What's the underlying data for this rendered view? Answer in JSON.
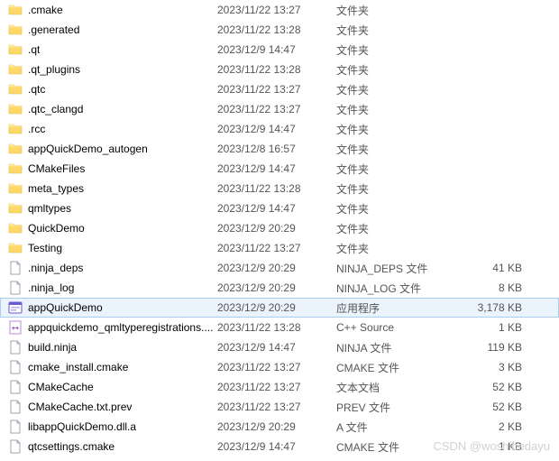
{
  "icons": {
    "folder": "folder",
    "file": "file",
    "exe": "exe",
    "cpp": "cpp"
  },
  "types": {
    "folder": "文件夹",
    "ninja_deps": "NINJA_DEPS 文件",
    "ninja_log": "NINJA_LOG 文件",
    "app": "应用程序",
    "cpp_source": "C++ Source",
    "ninja_file": "NINJA 文件",
    "cmake_file": "CMAKE 文件",
    "txt": "文本文档",
    "prev": "PREV 文件",
    "a_file": "A 文件"
  },
  "rows": [
    {
      "icon": "folder",
      "name": ".cmake",
      "date": "2023/11/22 13:27",
      "type": "folder",
      "size": ""
    },
    {
      "icon": "folder",
      "name": ".generated",
      "date": "2023/11/22 13:28",
      "type": "folder",
      "size": ""
    },
    {
      "icon": "folder",
      "name": ".qt",
      "date": "2023/12/9 14:47",
      "type": "folder",
      "size": ""
    },
    {
      "icon": "folder",
      "name": ".qt_plugins",
      "date": "2023/11/22 13:28",
      "type": "folder",
      "size": ""
    },
    {
      "icon": "folder",
      "name": ".qtc",
      "date": "2023/11/22 13:27",
      "type": "folder",
      "size": ""
    },
    {
      "icon": "folder",
      "name": ".qtc_clangd",
      "date": "2023/11/22 13:27",
      "type": "folder",
      "size": ""
    },
    {
      "icon": "folder",
      "name": ".rcc",
      "date": "2023/12/9 14:47",
      "type": "folder",
      "size": ""
    },
    {
      "icon": "folder",
      "name": "appQuickDemo_autogen",
      "date": "2023/12/8 16:57",
      "type": "folder",
      "size": ""
    },
    {
      "icon": "folder",
      "name": "CMakeFiles",
      "date": "2023/12/9 14:47",
      "type": "folder",
      "size": ""
    },
    {
      "icon": "folder",
      "name": "meta_types",
      "date": "2023/11/22 13:28",
      "type": "folder",
      "size": ""
    },
    {
      "icon": "folder",
      "name": "qmltypes",
      "date": "2023/12/9 14:47",
      "type": "folder",
      "size": ""
    },
    {
      "icon": "folder",
      "name": "QuickDemo",
      "date": "2023/12/9 20:29",
      "type": "folder",
      "size": ""
    },
    {
      "icon": "folder",
      "name": "Testing",
      "date": "2023/11/22 13:27",
      "type": "folder",
      "size": ""
    },
    {
      "icon": "file",
      "name": ".ninja_deps",
      "date": "2023/12/9 20:29",
      "type": "ninja_deps",
      "size": "41 KB"
    },
    {
      "icon": "file",
      "name": ".ninja_log",
      "date": "2023/12/9 20:29",
      "type": "ninja_log",
      "size": "8 KB"
    },
    {
      "icon": "exe",
      "name": "appQuickDemo",
      "date": "2023/12/9 20:29",
      "type": "app",
      "size": "3,178 KB",
      "selected": true
    },
    {
      "icon": "cpp",
      "name": "appquickdemo_qmltyperegistrations....",
      "date": "2023/11/22 13:28",
      "type": "cpp_source",
      "size": "1 KB"
    },
    {
      "icon": "file",
      "name": "build.ninja",
      "date": "2023/12/9 14:47",
      "type": "ninja_file",
      "size": "119 KB"
    },
    {
      "icon": "file",
      "name": "cmake_install.cmake",
      "date": "2023/11/22 13:27",
      "type": "cmake_file",
      "size": "3 KB"
    },
    {
      "icon": "file",
      "name": "CMakeCache",
      "date": "2023/11/22 13:27",
      "type": "txt",
      "size": "52 KB"
    },
    {
      "icon": "file",
      "name": "CMakeCache.txt.prev",
      "date": "2023/11/22 13:27",
      "type": "prev",
      "size": "52 KB"
    },
    {
      "icon": "file",
      "name": "libappQuickDemo.dll.a",
      "date": "2023/12/9 20:29",
      "type": "a_file",
      "size": "2 KB"
    },
    {
      "icon": "file",
      "name": "qtcsettings.cmake",
      "date": "2023/12/9 14:47",
      "type": "cmake_file",
      "size": "1 KB"
    }
  ],
  "watermark": "CSDN @woshihedayu"
}
